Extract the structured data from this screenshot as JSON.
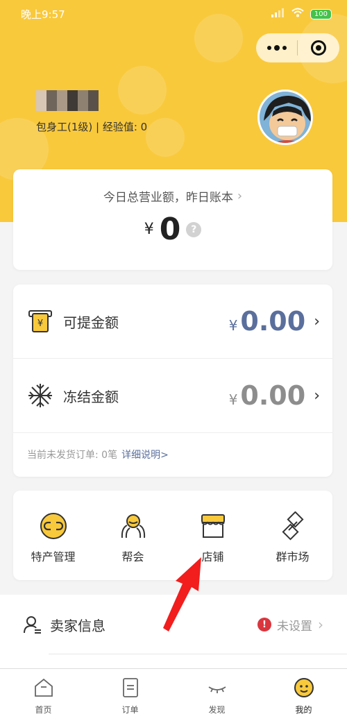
{
  "status_bar": {
    "time": "晚上9:57",
    "battery": "100"
  },
  "user": {
    "level": "包身工(1级) | 经验值: 0"
  },
  "revenue": {
    "title": "今日总营业额，昨日账本",
    "currency": "¥",
    "amount": "0",
    "help": "?"
  },
  "balance": {
    "withdrawable": {
      "label": "可提金额",
      "currency": "¥",
      "amount": "0.00"
    },
    "frozen": {
      "label": "冻结金额",
      "currency": "¥",
      "amount": "0.00"
    },
    "pending_text": "当前未发货订单: 0笔",
    "detail_link": "详细说明>"
  },
  "tools": [
    {
      "label": "特产管理",
      "icon": "link-icon"
    },
    {
      "label": "帮会",
      "icon": "group-icon"
    },
    {
      "label": "店铺",
      "icon": "shop-icon"
    },
    {
      "label": "群市场",
      "icon": "market-icon"
    }
  ],
  "seller": {
    "label": "卖家信息",
    "status": "未设置"
  },
  "tabbar": [
    {
      "label": "首页",
      "icon": "home-icon"
    },
    {
      "label": "订单",
      "icon": "order-icon"
    },
    {
      "label": "发现",
      "icon": "eye-icon"
    },
    {
      "label": "我的",
      "icon": "profile-icon"
    }
  ],
  "colors": {
    "brand_yellow": "#f9c93c",
    "accent_blue": "#5a6f9c",
    "alert_red": "#d9363e",
    "annotation_red": "#f21d1d"
  }
}
